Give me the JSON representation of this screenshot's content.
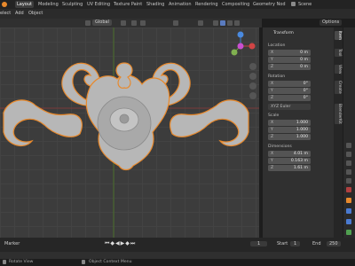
{
  "topbar": {
    "tabs": [
      "Layout",
      "Modeling",
      "Sculpting",
      "UV Editing",
      "Texture Paint",
      "Shading",
      "Animation",
      "Rendering",
      "Compositing",
      "Geometry Nod"
    ],
    "active_tab": "Layout",
    "scene": "Scene"
  },
  "menubar": {
    "items": [
      "elect",
      "Add",
      "Object"
    ]
  },
  "header": {
    "transform_orientation": "Global",
    "options": "Options"
  },
  "npanel": {
    "section": "Transform",
    "location": {
      "label": "Location",
      "x": "0 m",
      "y": "0 m",
      "z": "0 m"
    },
    "rotation": {
      "label": "Rotation",
      "x": "0°",
      "y": "0°",
      "z": "0°",
      "mode": "XYZ Euler"
    },
    "scale": {
      "label": "Scale",
      "x": "1.000",
      "y": "1.000",
      "z": "1.000"
    },
    "dimensions": {
      "label": "Dimensions",
      "x": "4.01 m",
      "y": "0.163 m",
      "z": "1.61 m"
    },
    "axes": [
      "X",
      "Y",
      "Z"
    ]
  },
  "sidetabs": [
    "Item",
    "Tool",
    "View",
    "Create",
    "BlenderKit"
  ],
  "timeline": {
    "marker": "Marker",
    "current_frame": "1",
    "start_label": "Start",
    "start_value": "1",
    "end_label": "End",
    "end_value": "250"
  },
  "status": {
    "rotate_view": "Rotate View",
    "context_menu": "Object Context Menu"
  },
  "colors": {
    "accent": "#e8892c",
    "selected_outline": "#f0a040",
    "grid": "#434343"
  }
}
